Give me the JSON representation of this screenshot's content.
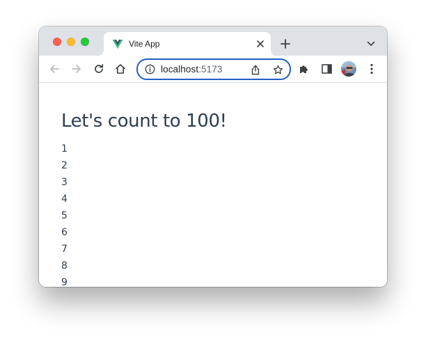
{
  "browser": {
    "tab": {
      "title": "Vite App",
      "favicon": "vue-logo-icon"
    },
    "omnibox": {
      "host": "localhost",
      "port": ":5173"
    },
    "accent_color": "#1f5fc4"
  },
  "page": {
    "heading": "Let's count to 100!",
    "items": [
      "1",
      "2",
      "3",
      "4",
      "5",
      "6",
      "7",
      "8",
      "9"
    ],
    "text_color": "#2c3e50"
  }
}
